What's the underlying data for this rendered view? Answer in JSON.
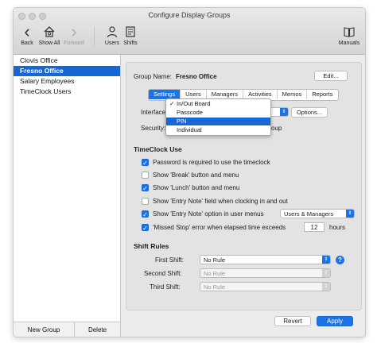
{
  "window": {
    "title": "Configure Display Groups"
  },
  "toolbar": {
    "back": "Back",
    "show_all": "Show All",
    "forward": "Forward",
    "users": "Users",
    "shifts": "Shifts",
    "manuals": "Manuals"
  },
  "sidebar": {
    "items": [
      {
        "label": "Clovis Office",
        "selected": false
      },
      {
        "label": "Fresno Office",
        "selected": true
      },
      {
        "label": "Salary Employees",
        "selected": false
      },
      {
        "label": "TimeClock Users",
        "selected": false
      }
    ],
    "new_group": "New Group",
    "delete": "Delete"
  },
  "group": {
    "name_label": "Group Name:",
    "name_value": "Fresno Office",
    "edit_button": "Edit..."
  },
  "tabs": [
    "Settings",
    "Users",
    "Managers",
    "Activities",
    "Memos",
    "Reports"
  ],
  "active_tab": "Settings",
  "settings": {
    "interface_label": "Interface:",
    "options_button": "Options...",
    "security_label": "Security:",
    "security_value_fragment": "oup"
  },
  "interface_menu": {
    "items": [
      {
        "label": "In/Out Board",
        "checked": true,
        "highlighted": false
      },
      {
        "label": "Passcode",
        "checked": false,
        "highlighted": false
      },
      {
        "label": "PIN",
        "checked": false,
        "highlighted": true
      },
      {
        "label": "Individual",
        "checked": false,
        "highlighted": false
      }
    ],
    "check_glyph": "✓"
  },
  "timeclock_use": {
    "heading": "TimeClock Use",
    "options": [
      {
        "label": "Password is required to use the timeclock",
        "checked": true
      },
      {
        "label": "Show 'Break' button and menu",
        "checked": false
      },
      {
        "label": "Show 'Lunch' button and menu",
        "checked": true
      },
      {
        "label": "Show 'Entry Note' field when clocking in and out",
        "checked": false
      },
      {
        "label": "Show 'Entry Note' option in user menus",
        "checked": true
      },
      {
        "label": "'Missed Stop' error when elapsed time exceeds",
        "checked": true
      }
    ],
    "entry_note_select": "Users & Managers",
    "missed_stop_value": "12",
    "missed_stop_unit": "hours"
  },
  "shift_rules": {
    "heading": "Shift Rules",
    "first_label": "First Shift:",
    "first_value": "No Rule",
    "second_label": "Second Shift:",
    "second_value": "No Rule",
    "third_label": "Third Shift:",
    "third_value": "No Rule",
    "help_glyph": "?"
  },
  "footer": {
    "revert": "Revert",
    "apply": "Apply"
  },
  "icons": {
    "check": "✓",
    "select_arrows": "⇕",
    "back": "‹",
    "forward": "›"
  },
  "colors": {
    "accent": "#1b73e8",
    "selection": "#1666d4"
  }
}
